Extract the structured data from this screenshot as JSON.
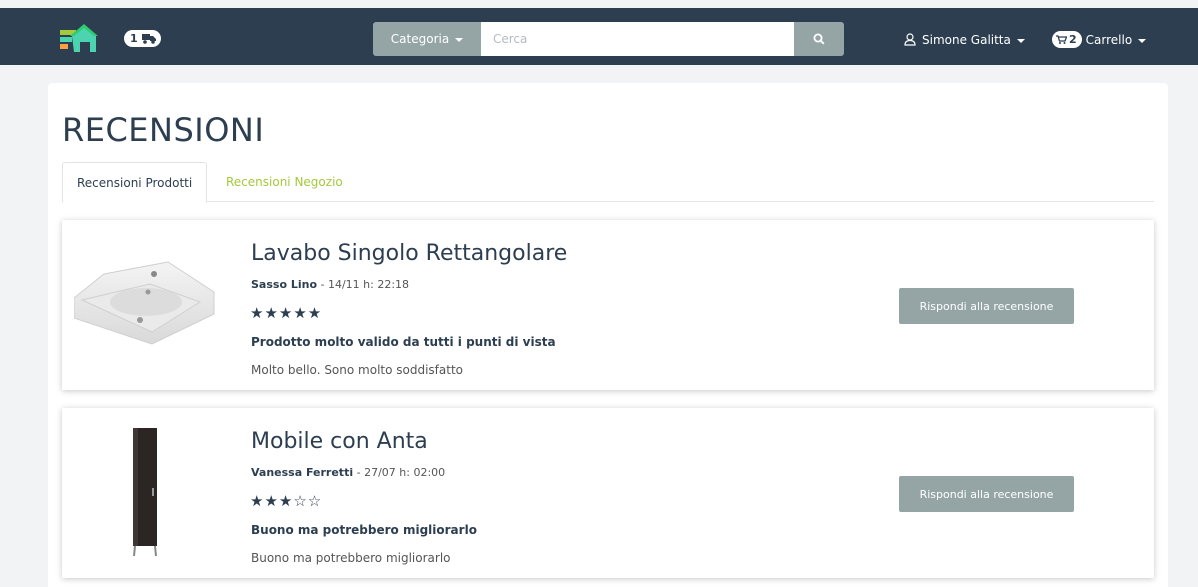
{
  "navbar": {
    "orders_badge": "1",
    "category_label": "Categoria",
    "search_placeholder": "Cerca",
    "user_name": "Simone Galitta",
    "cart_count": "2",
    "cart_label": "Carrello"
  },
  "page": {
    "title": "RECENSIONI",
    "tabs": [
      {
        "label": "Recensioni Prodotti",
        "active": true
      },
      {
        "label": "Recensioni Negozio",
        "active": false
      }
    ]
  },
  "reviews": [
    {
      "product": "Lavabo Singolo Rettangolare",
      "author": "Sasso Lino",
      "date": "- 14/11",
      "time": "h: 22:18",
      "stars": "★★★★★",
      "title": "Prodotto molto valido da tutti i punti di vista",
      "body": "Molto bello. Sono molto soddisfatto",
      "reply_label": "Rispondi alla recensione"
    },
    {
      "product": "Mobile con Anta",
      "author": "Vanessa Ferretti",
      "date": "- 27/07",
      "time": "h: 02:00",
      "stars": "★★★☆☆",
      "title": "Buono ma potrebbero migliorarlo",
      "body": "Buono ma potrebbero migliorarlo",
      "reply_label": "Rispondi alla recensione"
    }
  ],
  "colors": {
    "navbar": "#2c3e50",
    "button": "#95a5a6",
    "accent_green": "#a4c93b"
  }
}
